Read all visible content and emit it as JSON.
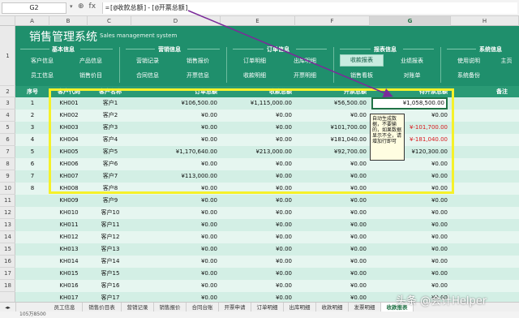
{
  "formula_bar": {
    "cell_ref": "G2",
    "cancel_icon": "✕",
    "confirm_icon": "✓",
    "fx_label": "fx",
    "formula": "=[@收款总额]-[@开票总额]"
  },
  "columns": [
    "A",
    "B",
    "C",
    "D",
    "E",
    "F",
    "G",
    "H"
  ],
  "row_numbers": [
    "1",
    "2",
    "3",
    "4",
    "5",
    "6",
    "7",
    "8",
    "9",
    "10",
    "11",
    "12",
    "13",
    "14",
    "15",
    "16",
    "17",
    "18"
  ],
  "banner": {
    "title": "销售管理系统",
    "subtitle": "Sales management system",
    "groups": [
      {
        "title": "基本信息",
        "buttons": [
          "客户信息",
          "产品信息",
          "员工信息",
          "销售价目"
        ]
      },
      {
        "title": "营销信息",
        "buttons": [
          "营销记录",
          "销售报价",
          "合同信息",
          "开票信息"
        ]
      },
      {
        "title": "订单信息",
        "buttons": [
          "订单明细",
          "出库明细",
          "收款明细",
          "开票明细"
        ]
      },
      {
        "title": "报表信息",
        "buttons": [
          "收款报表",
          "业绩报表",
          "销售看板",
          "对账单"
        ]
      },
      {
        "title": "系统信息",
        "buttons": [
          "使用说明",
          "主页",
          "系统备份"
        ]
      }
    ]
  },
  "table": {
    "headers": [
      "序号",
      "客户代码",
      "客户名称",
      "订单总额",
      "收款总额",
      "开票总额",
      "待开票总额",
      "备注"
    ],
    "rows": [
      [
        "1",
        "KH001",
        "客户1",
        "¥106,500.00",
        "¥1,115,000.00",
        "¥56,500.00",
        "¥1,058,500.00",
        ""
      ],
      [
        "2",
        "KH002",
        "客户2",
        "¥0.00",
        "¥0.00",
        "¥0.00",
        "¥0.00",
        ""
      ],
      [
        "3",
        "KH003",
        "客户3",
        "¥0.00",
        "¥0.00",
        "¥101,700.00",
        "¥-101,700.00",
        ""
      ],
      [
        "4",
        "KH004",
        "客户4",
        "¥0.00",
        "¥0.00",
        "¥181,040.00",
        "¥-181,040.00",
        ""
      ],
      [
        "5",
        "KH005",
        "客户5",
        "¥1,170,640.00",
        "¥213,000.00",
        "¥92,700.00",
        "¥120,300.00",
        ""
      ],
      [
        "6",
        "KH006",
        "客户6",
        "¥0.00",
        "¥0.00",
        "¥0.00",
        "¥0.00",
        ""
      ],
      [
        "7",
        "KH007",
        "客户7",
        "¥113,000.00",
        "¥0.00",
        "¥0.00",
        "¥0.00",
        ""
      ],
      [
        "8",
        "KH008",
        "客户8",
        "¥0.00",
        "¥0.00",
        "¥0.00",
        "¥0.00",
        ""
      ],
      [
        "",
        "KH009",
        "客户9",
        "¥0.00",
        "¥0.00",
        "¥0.00",
        "¥0.00",
        ""
      ],
      [
        "",
        "KH010",
        "客户10",
        "¥0.00",
        "¥0.00",
        "¥0.00",
        "¥0.00",
        ""
      ],
      [
        "",
        "KH011",
        "客户11",
        "¥0.00",
        "¥0.00",
        "¥0.00",
        "¥0.00",
        ""
      ],
      [
        "",
        "KH012",
        "客户12",
        "¥0.00",
        "¥0.00",
        "¥0.00",
        "¥0.00",
        ""
      ],
      [
        "",
        "KH013",
        "客户13",
        "¥0.00",
        "¥0.00",
        "¥0.00",
        "¥0.00",
        ""
      ],
      [
        "",
        "KH014",
        "客户14",
        "¥0.00",
        "¥0.00",
        "¥0.00",
        "¥0.00",
        ""
      ],
      [
        "",
        "KH015",
        "客户15",
        "¥0.00",
        "¥0.00",
        "¥0.00",
        "¥0.00",
        ""
      ],
      [
        "",
        "KH016",
        "客户16",
        "¥0.00",
        "¥0.00",
        "¥0.00",
        "¥0.00",
        ""
      ],
      [
        "",
        "KH017",
        "客户17",
        "¥0.00",
        "¥0.00",
        "¥0.00",
        "¥0.00",
        ""
      ]
    ],
    "negative_color": "#d9191c"
  },
  "comment": "自动生成数据，不要输的，如果数据显示不全，请增加行即可",
  "sheet_tabs": [
    "员工信息",
    "销售价目表",
    "营销记录",
    "销售报价",
    "合同台账",
    "开票申请",
    "订单明细",
    "出库明细",
    "收款明细",
    "发票明细",
    "收款报表"
  ],
  "active_tab": "收款报表",
  "status_text": "105万8500",
  "watermark": "头条 @会计Helper",
  "colors": {
    "banner": "#1f8f6c",
    "header": "#2a9a75",
    "row_odd": "#d3efe5",
    "row_even": "#e6f6f0",
    "highlight": "#f5f12a",
    "arrow": "#7b2b9a"
  }
}
